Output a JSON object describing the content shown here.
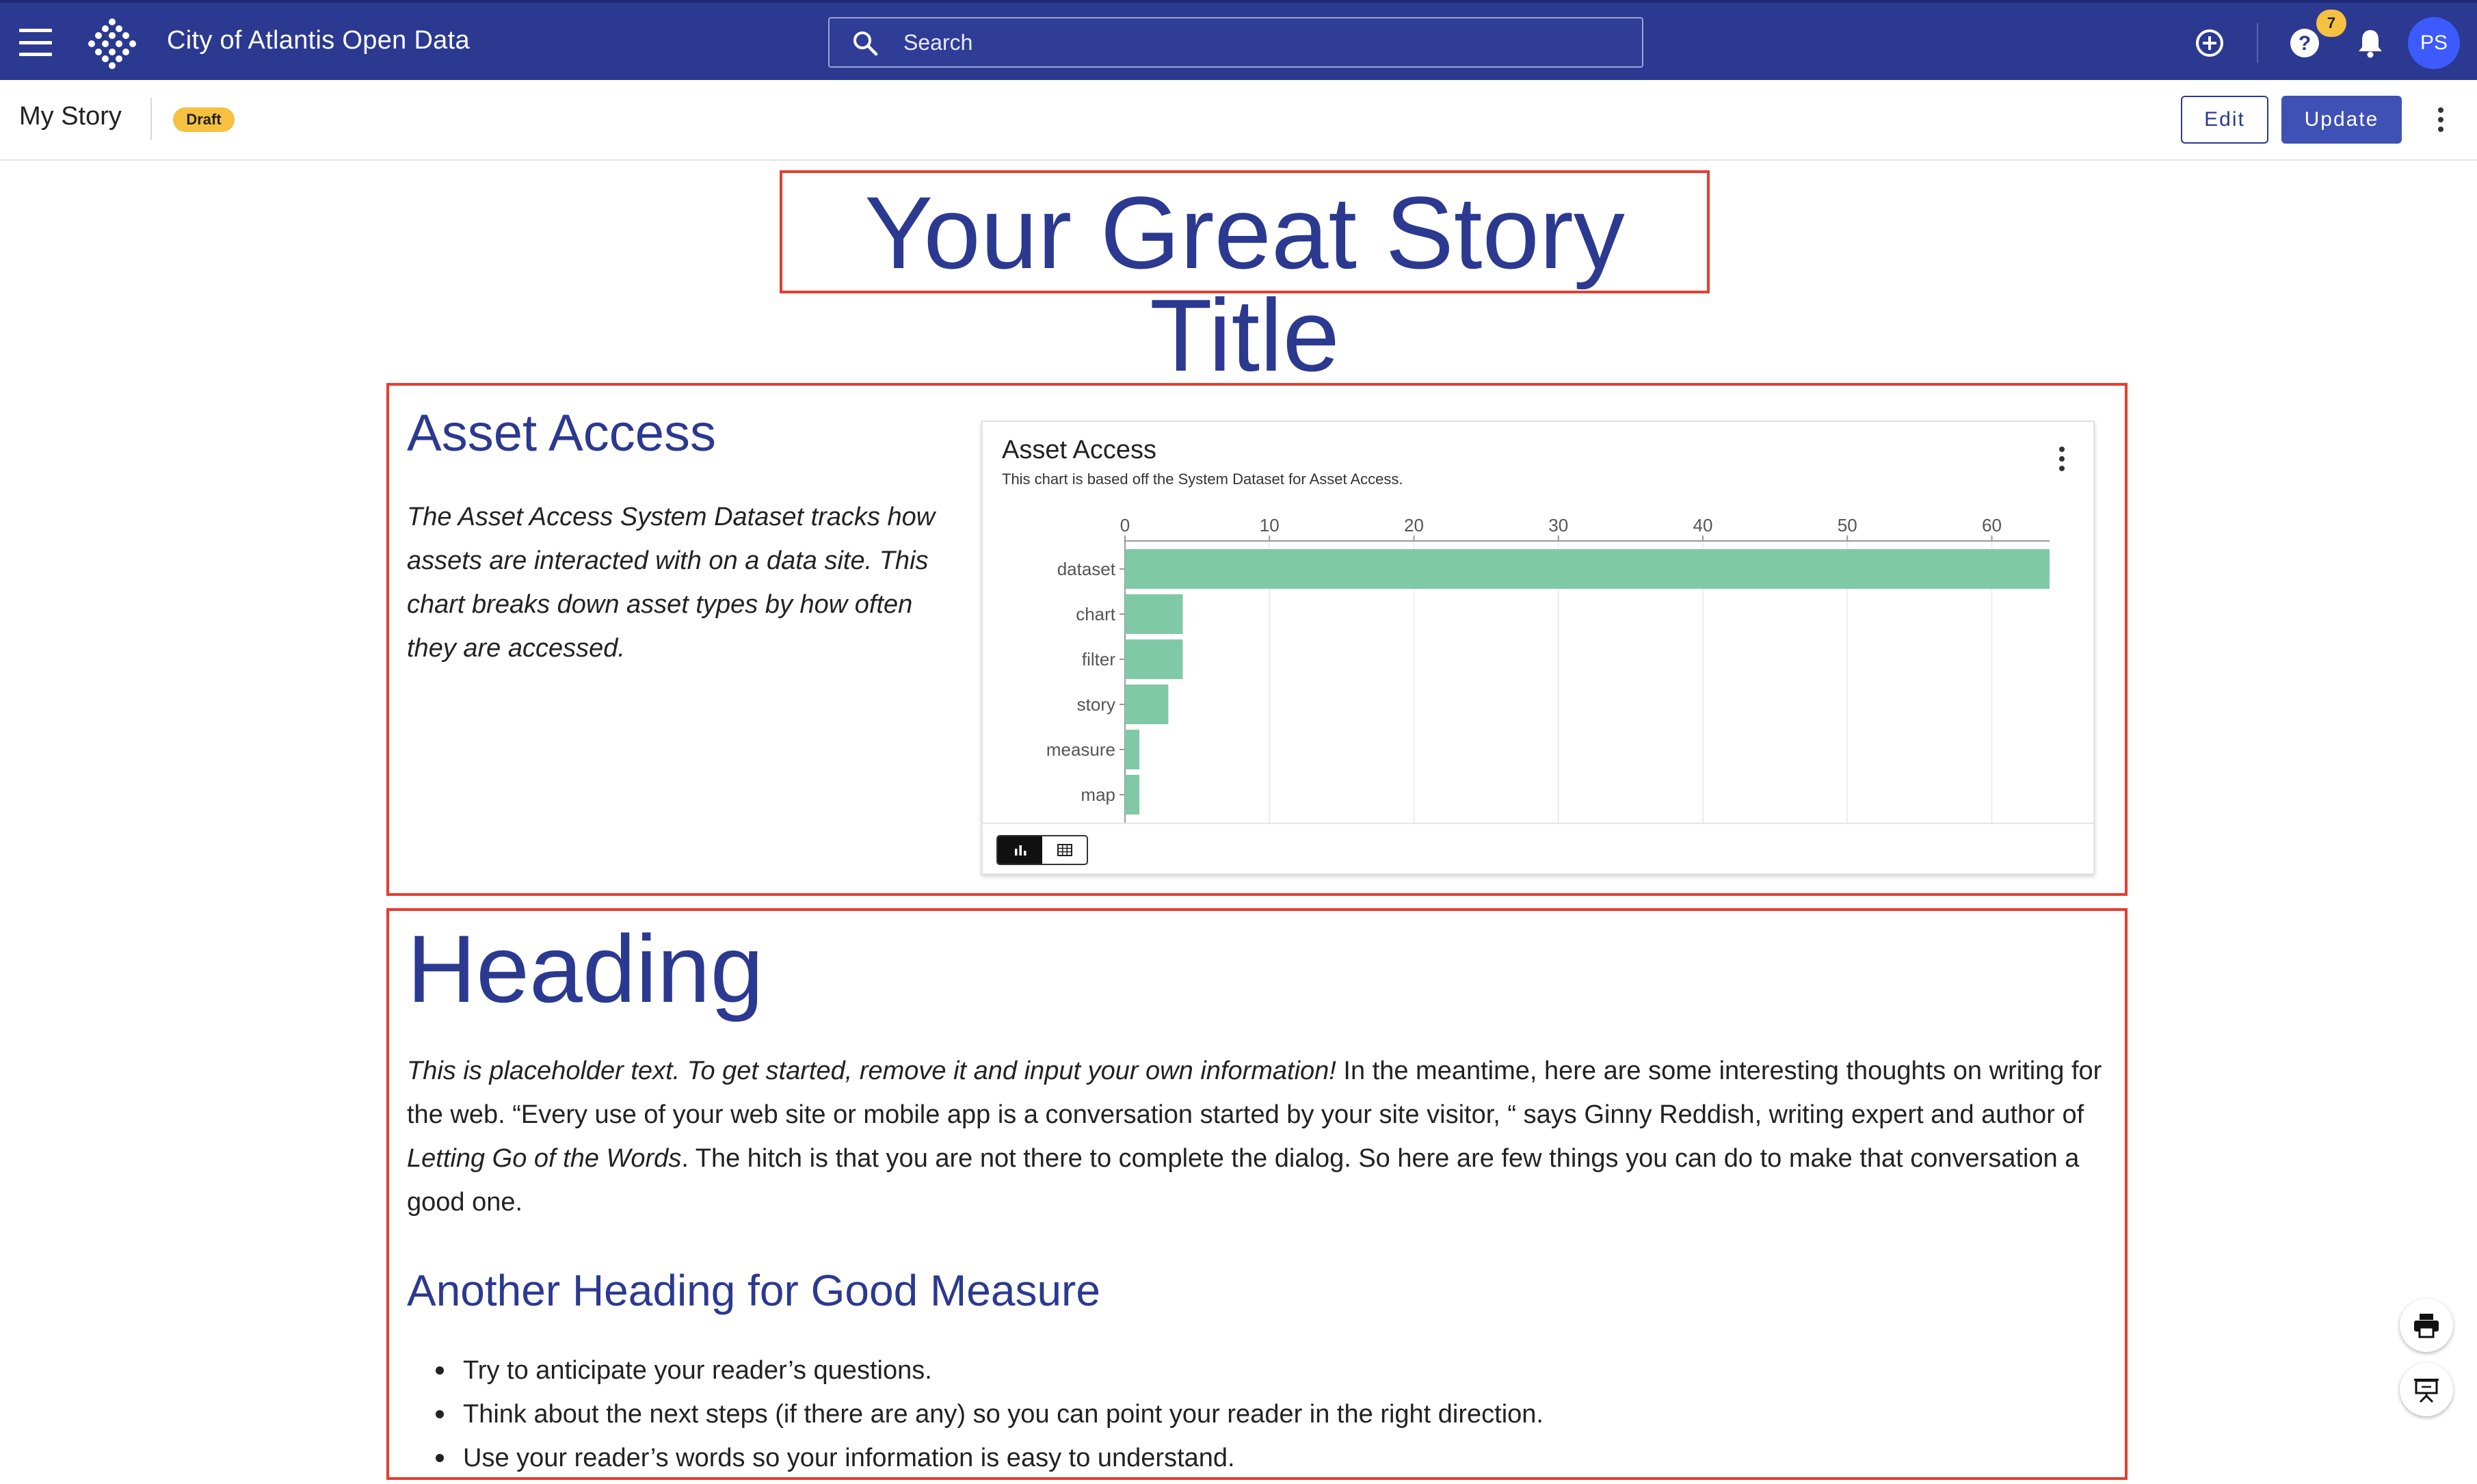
{
  "appbar": {
    "title": "City of Atlantis Open Data",
    "search_placeholder": "Search",
    "help_badge_count": "7",
    "avatar_initials": "PS",
    "color": "#2b3990"
  },
  "toolbar": {
    "story_name": "My Story",
    "status_badge": "Draft",
    "edit_label": "Edit",
    "update_label": "Update"
  },
  "story": {
    "title": "Your Great Story Title",
    "section1": {
      "heading": "Asset Access",
      "text": "The Asset Access System Dataset tracks how assets are interacted with on a data site. This chart breaks down asset types by how often they are accessed."
    },
    "section2": {
      "heading": "Heading",
      "para_italic": "This is placeholder text. To get started, remove it and input your own information!",
      "para_part1": " In the meantime, here are some interesting thoughts on writing for the web. “Every use of your web site or mobile app is a conversation started by your site visitor, “ says Ginny Reddish, writing expert and author of ",
      "para_book": "Letting Go of the Words",
      "para_part2": ". The hitch is that you are not there to complete the dialog. So here are few things you can do to make that conversation a good one.",
      "subheading": "Another Heading for Good Measure",
      "bullets": [
        "Try to anticipate your reader’s questions.",
        "Think about the next steps (if there are any) so you can point your reader in the right direction.",
        "Use your reader’s words so your information is easy to understand."
      ]
    }
  },
  "chart_data": {
    "type": "bar",
    "orientation": "horizontal",
    "title": "Asset Access",
    "subtitle": "This chart is based off the System Dataset for Asset Access.",
    "categories": [
      "dataset",
      "chart",
      "filter",
      "story",
      "measure",
      "map"
    ],
    "values": [
      64,
      4,
      4,
      3,
      1,
      1
    ],
    "xlim": [
      0,
      64
    ],
    "xticks": [
      0,
      10,
      20,
      30,
      40,
      50,
      60
    ],
    "bar_color": "#80c9a6",
    "grid": true
  },
  "icons": {
    "menu": "hamburger-icon",
    "logo": "dots-logo-icon",
    "search": "search-icon",
    "add": "add-circle-icon",
    "help": "help-icon",
    "notifications": "bell-icon",
    "more": "more-vert-icon",
    "print": "print-icon",
    "present": "presentation-icon",
    "bar_view": "bar-chart-icon",
    "table_view": "table-icon"
  }
}
